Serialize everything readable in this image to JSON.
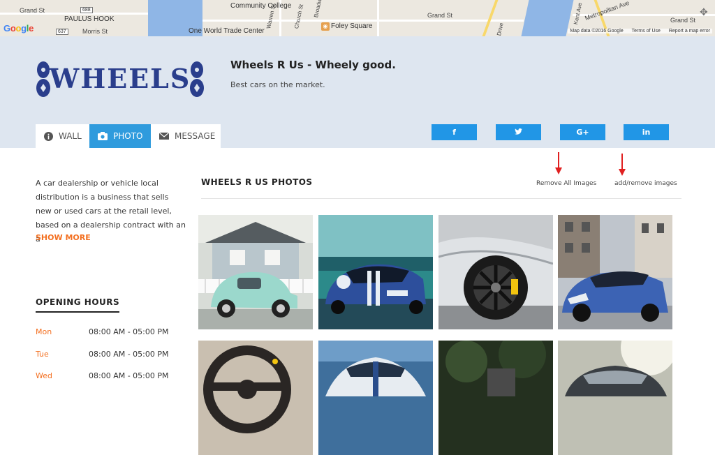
{
  "map": {
    "labels": {
      "grand_st_left": "Grand St",
      "paulus_hook": "PAULUS HOOK",
      "morris_st": "Morris St",
      "route_688": "688",
      "route_637": "637",
      "community_college": "Community College",
      "one_world": "One World Trade Center",
      "foley_square": "Foley Square",
      "warren_st": "Warren St",
      "church_st": "Church St",
      "broadway": "Broadway",
      "grand_st_right": "Grand St",
      "drive": "Drive",
      "metropolitan_ave": "Metropolitan Ave",
      "kent_ave": "Kent Ave",
      "grand_st_far": "Grand St"
    },
    "google": "Google",
    "map_data": "Map data ©2016 Google",
    "terms": "Terms of Use",
    "report": "Report a map error"
  },
  "brand": {
    "title": "Wheels R Us - Wheely good.",
    "tagline": "Best cars on the market."
  },
  "tabs": [
    {
      "label": "WALL",
      "icon": "info-icon"
    },
    {
      "label": "PHOTO",
      "icon": "camera-icon"
    },
    {
      "label": "MESSAGE",
      "icon": "envelope-icon"
    }
  ],
  "social": [
    {
      "label": "f",
      "icon": "facebook-icon"
    },
    {
      "label": "✓",
      "icon": "twitter-icon"
    },
    {
      "label": "G+",
      "icon": "google-plus-icon"
    },
    {
      "label": "in",
      "icon": "linkedin-icon"
    }
  ],
  "about": {
    "text": "A car dealership or vehicle local distribution is a business that sells new or used cars at the retail level, based on a dealership contract with an a",
    "more": "SHOW MORE"
  },
  "hours": {
    "title": "OPENING HOURS",
    "rows": [
      {
        "day": "Mon",
        "time": "08:00 AM - 05:00 PM"
      },
      {
        "day": "Tue",
        "time": "08:00 AM - 05:00 PM"
      },
      {
        "day": "Wed",
        "time": "08:00 AM - 05:00 PM"
      }
    ]
  },
  "gallery": {
    "title": "WHEELS R US PHOTOS",
    "remove_all": "Remove All Images",
    "add_remove": "add/remove images"
  },
  "colors": {
    "accent": "#2f9bdd",
    "social": "#2196e6",
    "orange": "#f37021",
    "header_bg": "#dee6f0",
    "logo_blue": "#2a3e8c",
    "arrow_red": "#e02020"
  }
}
